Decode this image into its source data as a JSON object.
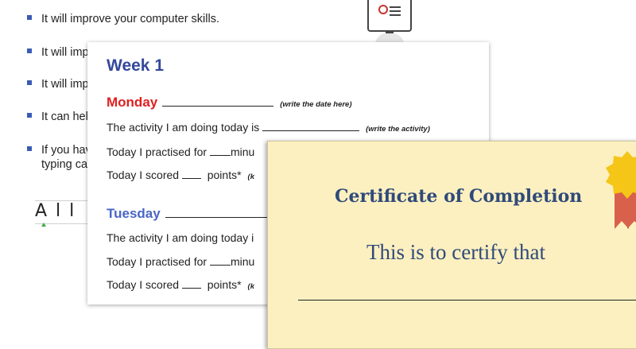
{
  "bullets": [
    {
      "text": "It will improve your computer skills."
    },
    {
      "text": "It will imp"
    },
    {
      "text": "It will imp"
    },
    {
      "text": "It can hel"
    },
    {
      "text": "If you hav",
      "continuation": "typing ca"
    }
  ],
  "handwriting_sample": "All",
  "week_card": {
    "title": "Week 1",
    "monday": {
      "day": "Monday",
      "hint": "(write the date here)",
      "activity_label": "The activity I am doing today is",
      "activity_hint": "(write the activity)",
      "practised_label": "Today I practised for",
      "practised_unit": "minu",
      "scored_label": "Today I scored",
      "scored_unit": "points*",
      "scored_hint": "(k"
    },
    "tuesday": {
      "day": "Tuesday",
      "activity_label": "The activity I am doing today i",
      "practised_label": "Today I practised for",
      "practised_unit": "minu",
      "scored_label": "Today I scored",
      "scored_unit": "points*",
      "scored_hint": "(k"
    }
  },
  "certificate": {
    "title": "Certificate of Completion",
    "subtitle": "This is to certify that"
  },
  "colors": {
    "bullet": "#3b5bb5",
    "week_title": "#34499a",
    "monday": "#e02020",
    "tuesday": "#4a66c7",
    "certificate_bg": "#fdf0c0",
    "certificate_text": "#2f4a7a",
    "seal": "#f5c518",
    "ribbon": "#d9604a"
  },
  "icons": [
    "certificate-icon",
    "seal-icon"
  ]
}
